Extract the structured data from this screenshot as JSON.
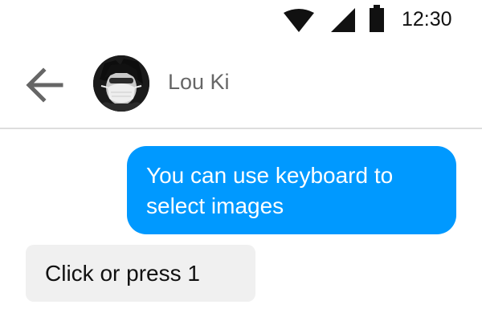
{
  "status_bar": {
    "time": "12:30",
    "icons": [
      "wifi-icon",
      "signal-icon",
      "battery-icon"
    ]
  },
  "header": {
    "back_icon": "arrow-left-icon",
    "contact_name": "Lou Ki"
  },
  "messages": [
    {
      "direction": "outgoing",
      "text": "You can use keyboard to select images"
    },
    {
      "direction": "incoming",
      "text": "Click or press 1"
    }
  ],
  "colors": {
    "outgoing_bubble": "#0099ff",
    "incoming_bubble": "#f0f0f0",
    "header_text": "#666666",
    "divider": "#dddddd"
  }
}
